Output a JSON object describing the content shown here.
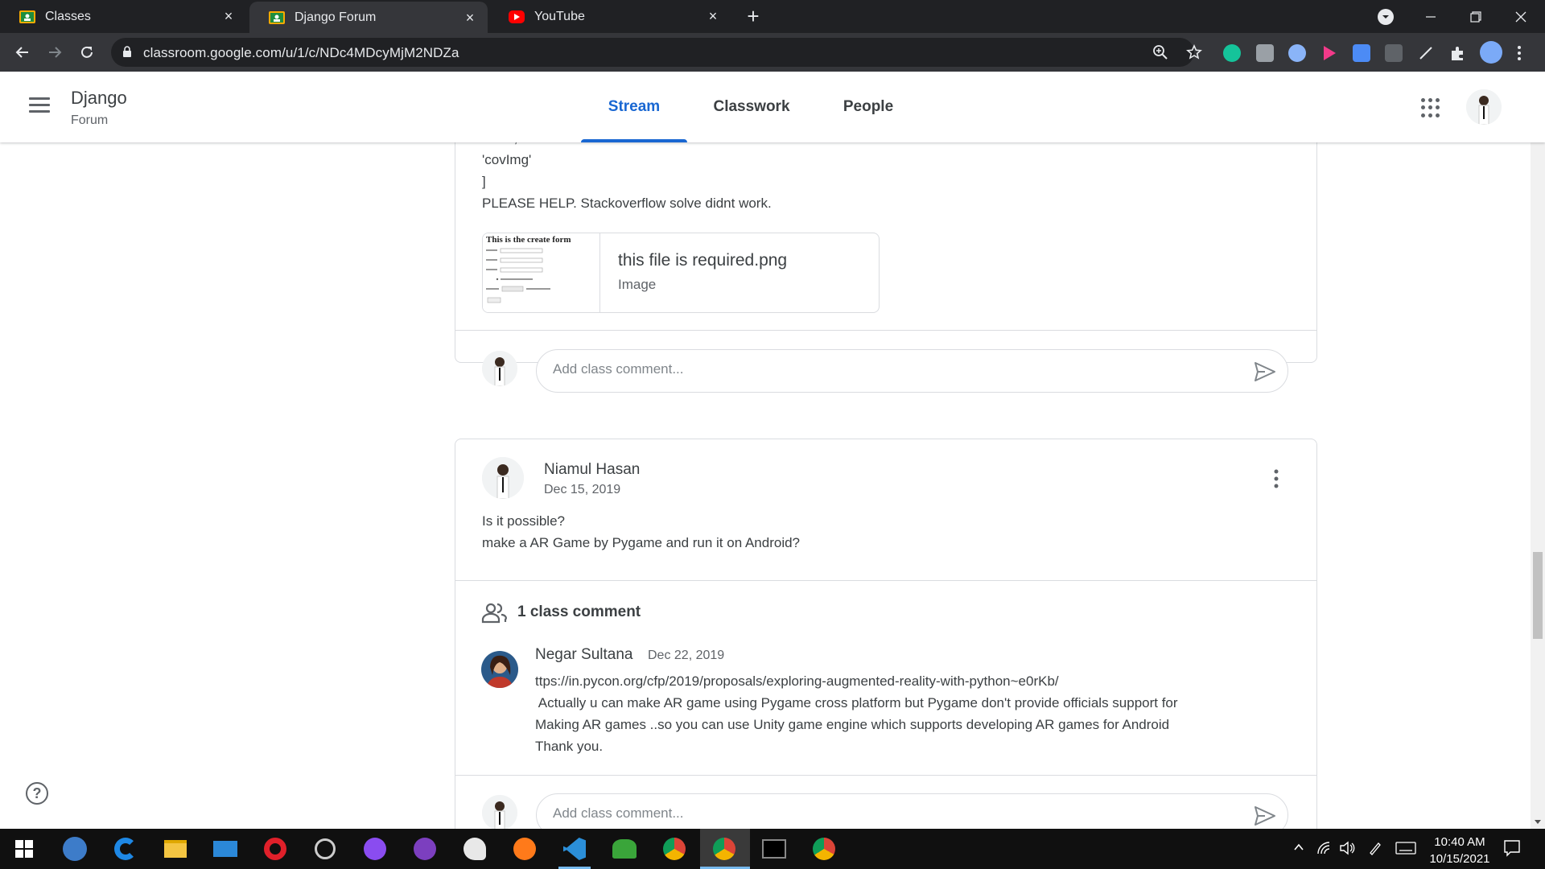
{
  "browser": {
    "tabs": [
      {
        "title": "Classes",
        "favicon": "classroom-favicon",
        "active": false
      },
      {
        "title": "Django Forum",
        "favicon": "classroom-favicon",
        "active": true
      },
      {
        "title": "YouTube",
        "favicon": "youtube-favicon",
        "active": false
      }
    ],
    "url": "classroom.google.com/u/1/c/NDc4MDcyMjM2NDZa"
  },
  "classroom": {
    "class_name": "Django",
    "class_section": "Forum",
    "tabs": [
      "Stream",
      "Classwork",
      "People"
    ],
    "active_tab": "Stream"
  },
  "posts": {
    "prev": {
      "lines": [
        "'date',",
        "'covImg'",
        "]",
        "PLEASE HELP. Stackoverflow solve didnt work."
      ],
      "attachment": {
        "name": "this file is required.png",
        "type": "Image",
        "thumb_title": "This is the create form"
      },
      "comment_placeholder": "Add class comment..."
    },
    "main": {
      "author": "Niamul Hasan",
      "date": "Dec 15, 2019",
      "lines": [
        "Is it possible?",
        "make a AR Game by Pygame and run it on Android?"
      ],
      "comment_count_label": "1 class comment",
      "comment": {
        "author": "Negar Sultana",
        "date": "Dec 22, 2019",
        "lines": [
          "ttps://in.pycon.org/cfp/2019/proposals/exploring-augmented-reality-with-python~e0rKb/",
          " Actually u can make AR game using Pygame cross platform but Pygame don't provide officials support for",
          "Making AR games ..so you can use Unity game engine which supports developing AR games for Android",
          "Thank you."
        ]
      },
      "comment_placeholder": "Add class comment..."
    }
  },
  "help_label": "?",
  "taskbar": {
    "time": "10:40 AM",
    "date": "10/15/2021"
  },
  "colors": {
    "accent": "#1967d2",
    "chrome_dark": "#202124",
    "chrome_toolbar": "#35363a",
    "taskbar": "#101010"
  }
}
